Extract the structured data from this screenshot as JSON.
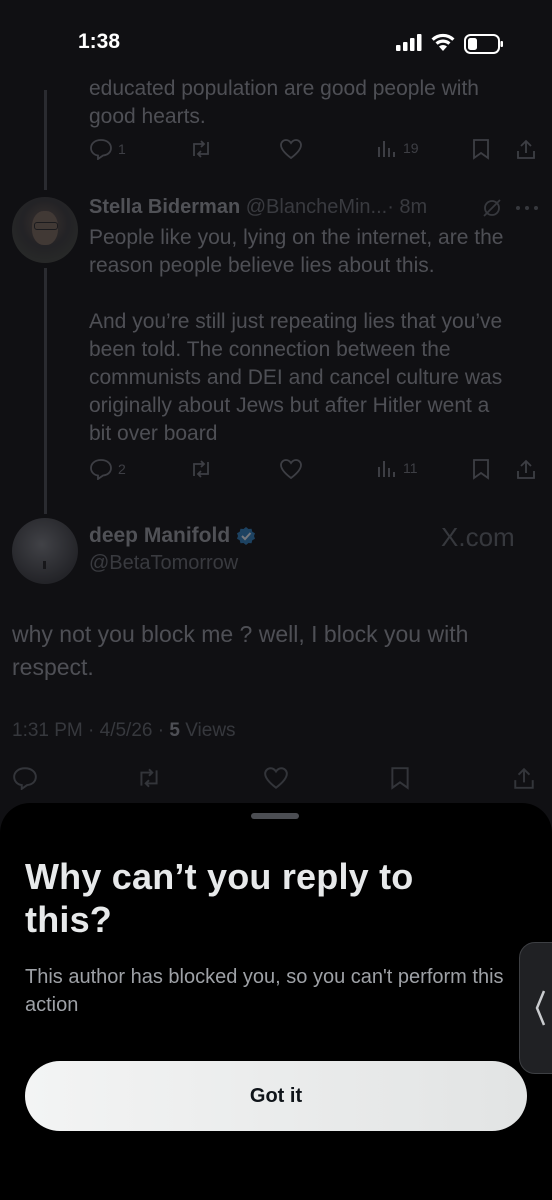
{
  "status_bar": {
    "time": "1:38"
  },
  "thread": {
    "previous_tweet": {
      "text_lines": [
        "educated population are good people with",
        "good hearts."
      ],
      "reply_count": "1",
      "view_count": "19"
    },
    "reply_tweet": {
      "author_name": "Stella Biderman",
      "author_handle": "@BlancheMin...",
      "time_ago": "· 8m",
      "paragraph1": [
        "People like you, lying on the internet, are the",
        "reason people believe lies about this."
      ],
      "paragraph2": [
        "And you’re still just repeating lies that you’ve",
        "been told. The connection between the",
        "communists and DEI and cancel culture was",
        "originally about Jews but after Hitler went a",
        "bit over board"
      ],
      "reply_count": "2",
      "view_count": "11"
    },
    "main_tweet": {
      "author_name": "deep Manifold",
      "author_handle": "@BetaTomorrow",
      "watermark": "X.com",
      "text": "why not you block me ? well, I block you with respect.",
      "timestamp": "1:31 PM · 4/5/26 · ",
      "views_count": "5",
      "views_label": "Views"
    }
  },
  "sheet": {
    "title": "Why can’t you reply to this?",
    "body": "This author has blocked you, so you can't perform this action",
    "button_label": "Got it"
  },
  "icons": {
    "reply": "reply-icon",
    "retweet": "retweet-icon",
    "like": "like-icon",
    "views": "views-icon",
    "bookmark": "bookmark-icon",
    "share": "share-icon",
    "verified": "verified-badge-icon",
    "grok": "grok-icon",
    "more": "more-icon",
    "side_tab": "chevron-left-icon"
  },
  "colors": {
    "verified": "#1d9bf0",
    "sheet_bg": "#000000",
    "button_bg": "#eff1f1"
  }
}
